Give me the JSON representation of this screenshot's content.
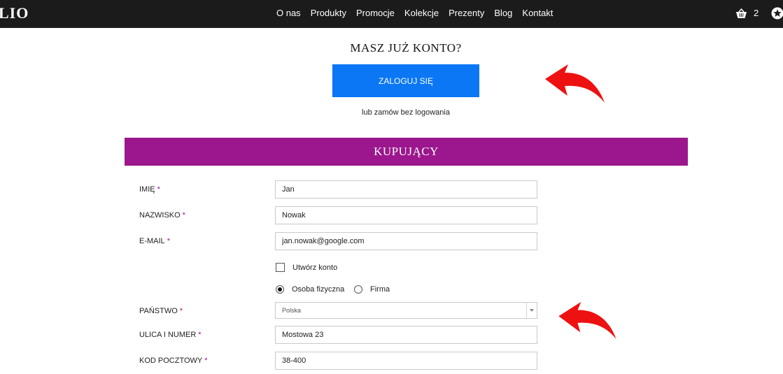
{
  "header": {
    "logo_text": "LIO",
    "nav_items": [
      "O nas",
      "Produkty",
      "Promocje",
      "Kolekcje",
      "Prezenty",
      "Blog",
      "Kontakt"
    ],
    "cart_count": "2"
  },
  "login": {
    "title": "MASZ JUŻ KONTO?",
    "button_label": "ZALOGUJ SIĘ",
    "guest_text": "lub zamów bez logowania"
  },
  "section": {
    "title": "KUPUJĄCY"
  },
  "form": {
    "required_mark": "*",
    "first_name": {
      "label": "IMIĘ",
      "value": "Jan"
    },
    "last_name": {
      "label": "NAZWISKO",
      "value": "Nowak"
    },
    "email": {
      "label": "E-MAIL",
      "value": "jan.nowak@google.com"
    },
    "create_account": {
      "label": "Utwórz konto",
      "checked": false
    },
    "customer_type": {
      "options": [
        "Osoba fizyczna",
        "Firma"
      ],
      "selected": "Osoba fizyczna"
    },
    "country": {
      "label": "PAŃSTWO",
      "value": "Polska"
    },
    "street": {
      "label": "ULICA I NUMER",
      "value": "Mostowa 23"
    },
    "postal_code": {
      "label": "KOD POCZTOWY",
      "value": "38-400"
    }
  },
  "colors": {
    "topbar": "#1b1b1b",
    "login_button": "#0b77f5",
    "section_header": "#9c168d",
    "annotation_arrow": "#ee1111"
  }
}
